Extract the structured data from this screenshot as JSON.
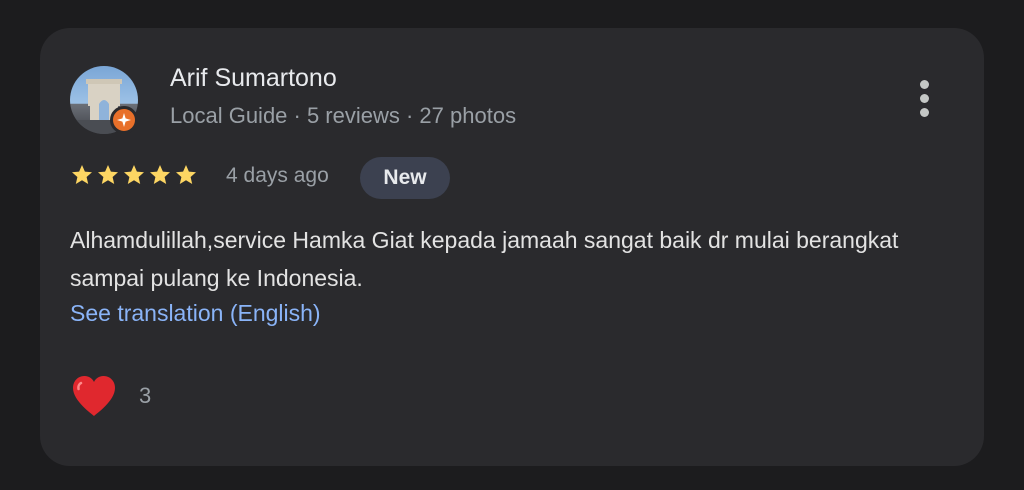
{
  "review": {
    "author_name": "Arif Sumartono",
    "author_meta": "Local Guide · 5 reviews · 27 photos",
    "rating": 5,
    "rating_max": 5,
    "date": "4 days ago",
    "badge": "New",
    "text": "Alhamdulillah,service Hamka Giat kepada jamaah sangat baik dr mulai berangkat sampai pulang ke Indonesia.",
    "translate_link": "See translation (English)",
    "likes": "3"
  },
  "icons": {
    "menu": "more-vert-icon",
    "like": "heart-icon",
    "guide": "local-guide-star-icon",
    "star": "star-icon"
  },
  "colors": {
    "background": "#1c1c1e",
    "card": "#2a2a2d",
    "star": "#fdd663",
    "link": "#8ab4f8",
    "heart": "#e0282e",
    "guide_badge": "#e8702a",
    "new_badge": "#3c4150"
  }
}
